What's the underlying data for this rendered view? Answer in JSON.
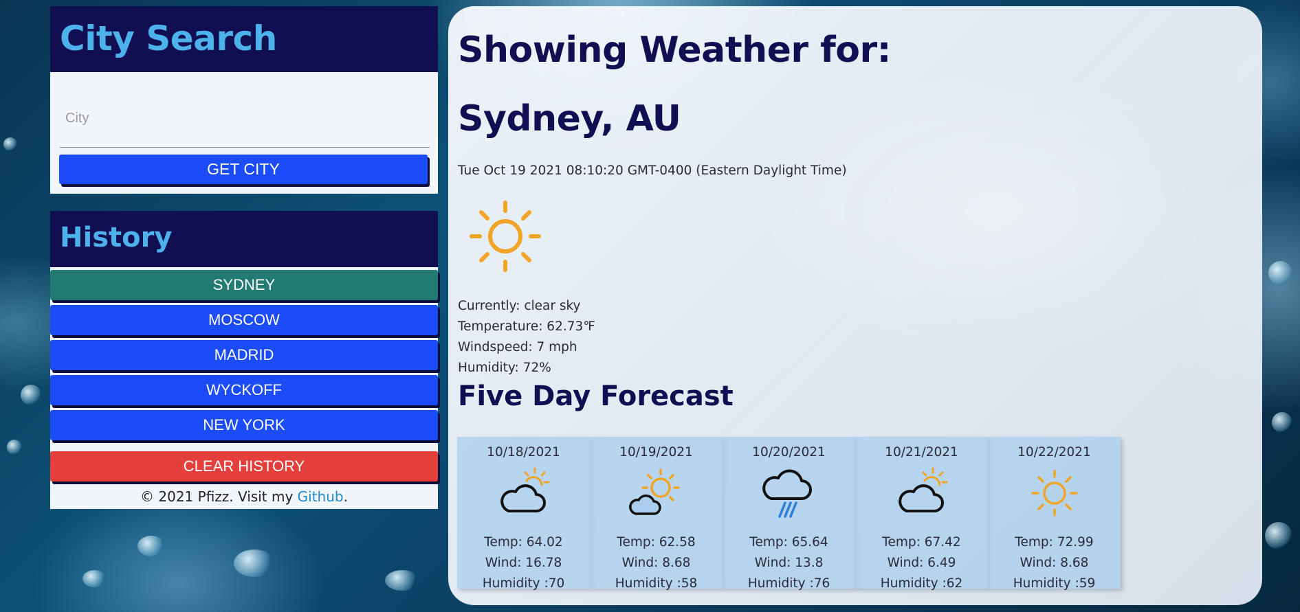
{
  "search": {
    "title": "City Search",
    "placeholder": "City",
    "value": "",
    "button_label": "GET CITY"
  },
  "history": {
    "title": "History",
    "items": [
      {
        "label": "SYDNEY",
        "active": true
      },
      {
        "label": "MOSCOW",
        "active": false
      },
      {
        "label": "MADRID",
        "active": false
      },
      {
        "label": "WYCKOFF",
        "active": false
      },
      {
        "label": "NEW YORK",
        "active": false
      }
    ],
    "clear_label": "CLEAR HISTORY"
  },
  "footer": {
    "prefix": "© 2021 Pfizz. Visit my ",
    "link_text": "Github",
    "suffix": "."
  },
  "main": {
    "heading": "Showing Weather for:",
    "city": "Sydney, AU",
    "datetime": "Tue Oct 19 2021 08:10:20 GMT-0400 (Eastern Daylight Time)",
    "icon": "sun-icon",
    "description": "Currently: clear sky",
    "temperature": "Temperature: 62.73℉",
    "windspeed": "Windspeed: 7 mph",
    "humidity": "Humidity: 72%"
  },
  "forecast": {
    "title": "Five Day Forecast",
    "days": [
      {
        "date": "10/18/2021",
        "icon": "cloud-sun-icon",
        "temp": "Temp: 64.02",
        "wind": "Wind: 16.78",
        "humidity": "Humidity :70"
      },
      {
        "date": "10/19/2021",
        "icon": "sun-cloud-icon",
        "temp": "Temp: 62.58",
        "wind": "Wind: 8.68",
        "humidity": "Humidity :58"
      },
      {
        "date": "10/20/2021",
        "icon": "rain-icon",
        "temp": "Temp: 65.64",
        "wind": "Wind: 13.8",
        "humidity": "Humidity :76"
      },
      {
        "date": "10/21/2021",
        "icon": "cloud-sun-icon",
        "temp": "Temp: 67.42",
        "wind": "Wind: 6.49",
        "humidity": "Humidity :62"
      },
      {
        "date": "10/22/2021",
        "icon": "sun-icon",
        "temp": "Temp: 72.99",
        "wind": "Wind: 8.68",
        "humidity": "Humidity :59"
      }
    ]
  },
  "colors": {
    "header_bg": "#120e52",
    "header_text": "#4db2ec",
    "button_blue": "#1b4cf7",
    "button_active": "#217b72",
    "button_clear": "#e53f3c",
    "sun": "#f0a526"
  }
}
